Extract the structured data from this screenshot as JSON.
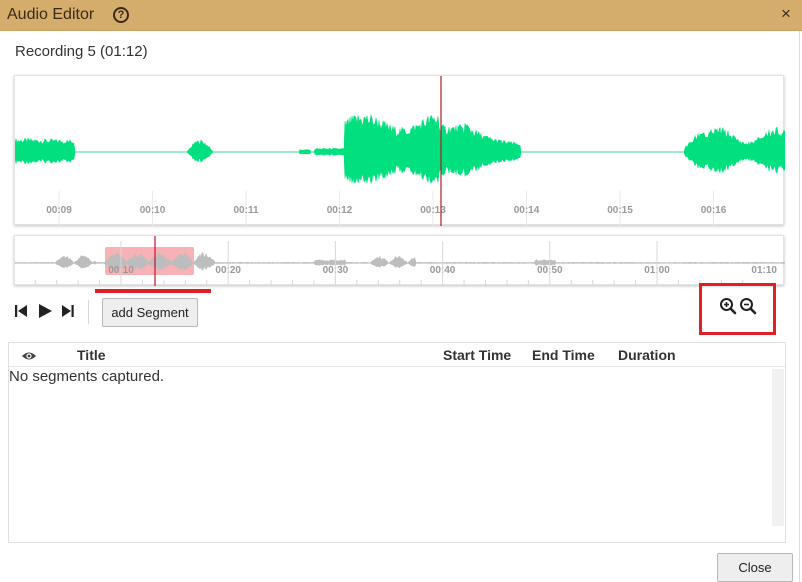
{
  "window": {
    "title": "Audio Editor",
    "close_glyph": "×",
    "help_glyph": "?"
  },
  "recording": {
    "title": "Recording 5 (01:12)"
  },
  "waveform": {
    "wave_color": "#00e07f",
    "playhead_color": "#b01c1c",
    "ticks": [
      "00:09",
      "00:10",
      "00:11",
      "00:12",
      "00:13",
      "00:14",
      "00:15",
      "00:16"
    ]
  },
  "overview": {
    "ticks": [
      "00:10",
      "00:20",
      "00:30",
      "00:40",
      "00:50",
      "01:00",
      "01:10"
    ],
    "selection_color": "#f7a5a8"
  },
  "controls": {
    "skip_back_icon": "skip-back-icon",
    "play_icon": "play-icon",
    "skip_forward_icon": "skip-forward-icon",
    "add_segment_label": "add Segment",
    "zoom_in_icon": "zoom-in-icon",
    "zoom_out_icon": "zoom-out-icon"
  },
  "segments_table": {
    "columns": [
      "Title",
      "Start Time",
      "End Time",
      "Duration"
    ],
    "visibility_icon": "eye-icon",
    "empty_message": "No segments captured."
  },
  "footer": {
    "close_label": "Close"
  },
  "annotation_color": "#e01f26"
}
